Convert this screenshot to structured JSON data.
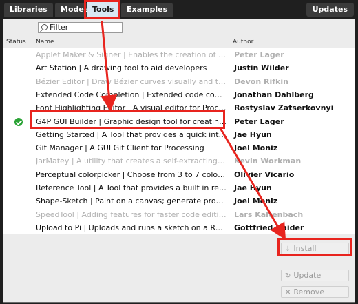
{
  "tabs": [
    {
      "label": "Libraries"
    },
    {
      "label": "Modes"
    },
    {
      "label": "Tools"
    },
    {
      "label": "Examples"
    }
  ],
  "updates_label": "Updates",
  "filter": {
    "placeholder": "Filter"
  },
  "columns": {
    "status": "Status",
    "name": "Name",
    "author": "Author"
  },
  "contributions": [
    {
      "name": "Applet Maker & Signer | Enables the creation of self-si...",
      "author": "Peter Lager",
      "dim": true,
      "installed": false
    },
    {
      "name": "Art Station | A drawing tool to aid developers",
      "author": "Justin Wilder",
      "dim": false,
      "installed": false
    },
    {
      "name": "Bézier Editor | Draw Bézier curves visually and then aut...",
      "author": "Devon Rifkin",
      "dim": true,
      "installed": false
    },
    {
      "name": "Extended Code Completion | Extended code completion...",
      "author": "Jonathan Dahlberg",
      "dim": false,
      "installed": false
    },
    {
      "name": "Font Highlighting Editor | A visual editor for Processin...",
      "author": "Rostyslav Zatserkovnyi",
      "dim": false,
      "installed": false
    },
    {
      "name": "G4P GUI Builder | Graphic design tool for creating user ...",
      "author": "Peter Lager",
      "dim": false,
      "installed": true
    },
    {
      "name": "Getting Started | A Tool that provides a quick introduct...",
      "author": "Jae Hyun",
      "dim": false,
      "installed": false
    },
    {
      "name": "Git Manager | A GUI Git Client for Processing",
      "author": "Joel Moniz",
      "dim": false,
      "installed": false
    },
    {
      "name": "JarMatey | A utility that creates a self-extracting jar th...",
      "author": "Kevin Workman",
      "dim": true,
      "installed": false
    },
    {
      "name": "Perceptual colorpicker | Choose from 3 to 7 colors fro...",
      "author": "Olivier Vicario",
      "dim": false,
      "installed": false
    },
    {
      "name": "Reference Tool | A Tool that provides a built in referen...",
      "author": "Jae Hyun",
      "dim": false,
      "installed": false
    },
    {
      "name": "Shape-Sketch | Paint on a canvas; generate processing ...",
      "author": "Joel Moniz",
      "dim": false,
      "installed": false
    },
    {
      "name": "SpeedTool | Adding features for faster code editing to ...",
      "author": "Lars Kaltenbach",
      "dim": true,
      "installed": false
    },
    {
      "name": "Upload to Pi | Uploads and runs a sketch on a Raspberr...",
      "author": "Gottfried Haider",
      "dim": false,
      "installed": false
    }
  ],
  "buttons": {
    "install": "Install",
    "update": "Update",
    "remove": "Remove"
  },
  "colors": {
    "highlight": "#e8241e",
    "installed_check": "#2ba336",
    "active_tab": "#d9e8f3"
  }
}
